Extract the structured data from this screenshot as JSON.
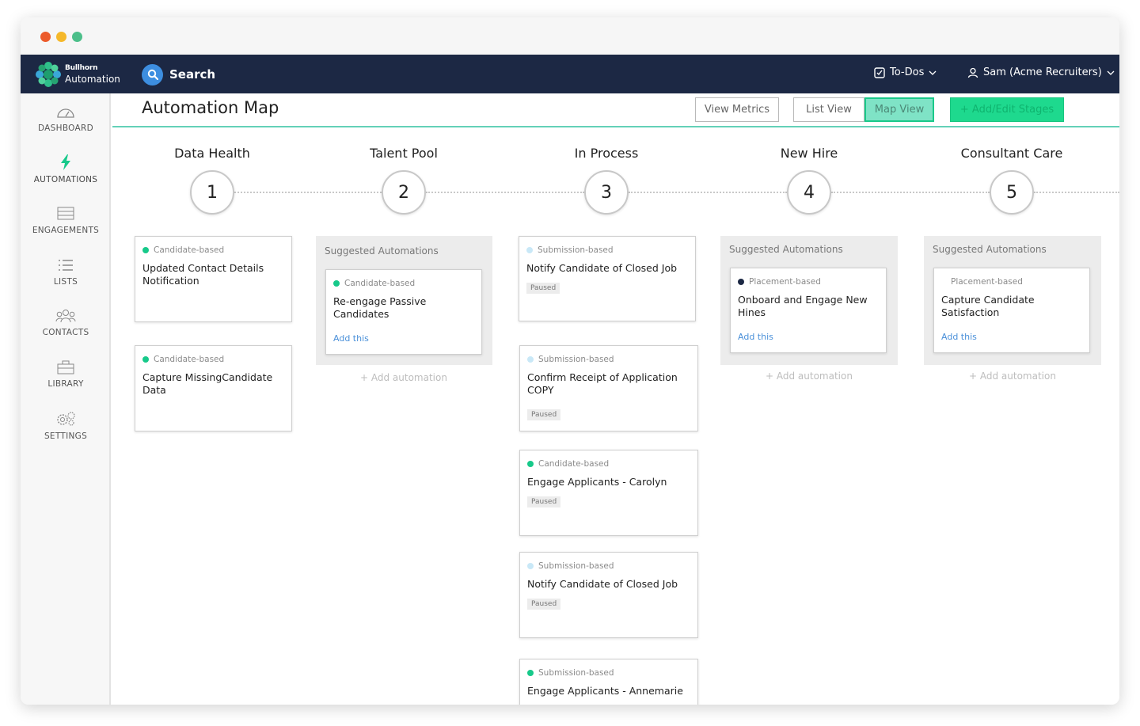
{
  "brand": {
    "line1": "Bullhorn",
    "line2": "Automation"
  },
  "topnav": {
    "search_label": "Search",
    "todos_label": "To-Dos",
    "user_label": "Sam (Acme Recruiters)"
  },
  "sidebar": {
    "items": [
      {
        "label": "DASHBOARD",
        "icon": "gauge-icon"
      },
      {
        "label": "AUTOMATIONS",
        "icon": "lightning-icon"
      },
      {
        "label": "ENGAGEMENTS",
        "icon": "engagements-icon"
      },
      {
        "label": "LISTS",
        "icon": "list-icon"
      },
      {
        "label": "CONTACTS",
        "icon": "people-icon"
      },
      {
        "label": "LIBRARY",
        "icon": "briefcase-icon"
      },
      {
        "label": "SETTINGS",
        "icon": "gear-icon"
      }
    ]
  },
  "header": {
    "title": "Automation Map",
    "view_metrics": "View Metrics",
    "list_view": "List View",
    "map_view": "Map View",
    "add_edit": "+ Add/Edit Stages"
  },
  "stages": [
    {
      "name": "Data Health",
      "number": "1"
    },
    {
      "name": "Talent Pool",
      "number": "2"
    },
    {
      "name": "In Process",
      "number": "3"
    },
    {
      "name": "New Hire",
      "number": "4"
    },
    {
      "name": "Consultant Care",
      "number": "5"
    }
  ],
  "colors": {
    "green": "#17c98a",
    "light_blue": "#c9e8f7",
    "navy": "#1c2844",
    "link": "#4a90d9"
  },
  "columns": {
    "data_health": {
      "cards": [
        {
          "type": "Candidate-based",
          "title": "Updated Contact Details Notification"
        },
        {
          "type": "Candidate-based",
          "title": "Capture MissingCandidate Data"
        }
      ]
    },
    "talent_pool": {
      "suggest_title": "Suggested Automations",
      "card": {
        "type": "Candidate-based",
        "title": "Re-engage Passive Candidates",
        "link": "Add this"
      },
      "add_automation": "+ Add automation"
    },
    "in_process": {
      "cards": [
        {
          "type": "Submission-based",
          "title": "Notify Candidate of Closed Job",
          "badge": "Paused"
        },
        {
          "type": "Submission-based",
          "title": "Confirm Receipt of Application COPY",
          "badge": "Paused"
        },
        {
          "type": "Candidate-based",
          "title": "Engage Applicants - Carolyn",
          "badge": "Paused"
        },
        {
          "type": "Submission-based",
          "title": "Notify Candidate of Closed Job",
          "badge": "Paused"
        },
        {
          "type": "Submission-based",
          "title": "Engage Applicants - Annemarie"
        }
      ]
    },
    "new_hire": {
      "suggest_title": "Suggested Automations",
      "card": {
        "type": "Placement-based",
        "title": "Onboard and Engage New Hines",
        "link": "Add this"
      },
      "add_automation": "+ Add automation"
    },
    "consultant_care": {
      "suggest_title": "Suggested Automations",
      "card": {
        "type": "Placement-based",
        "title": "Capture Candidate Satisfaction",
        "link": "Add this"
      },
      "add_automation": "+ Add automation"
    }
  }
}
